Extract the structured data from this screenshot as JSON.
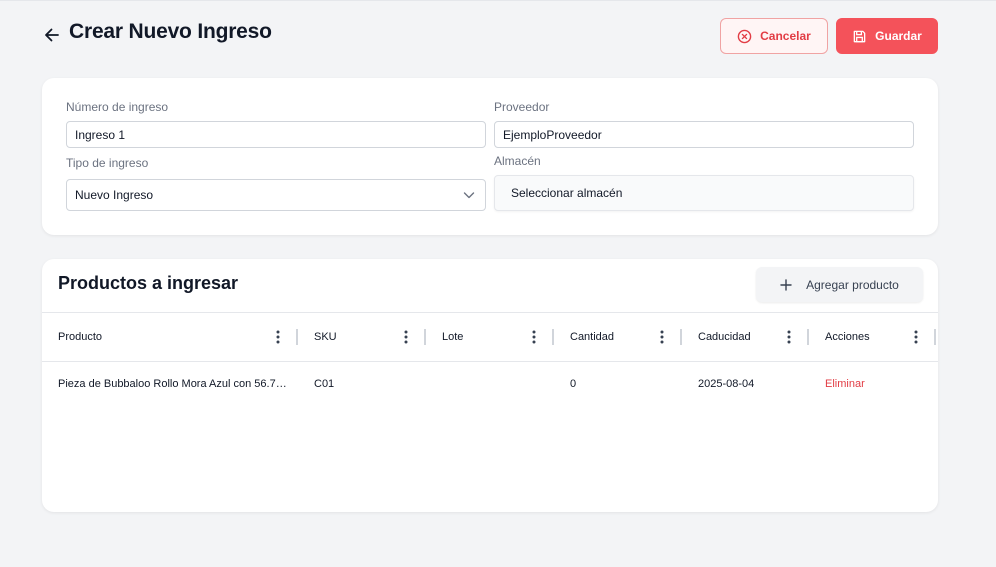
{
  "header": {
    "title": "Crear Nuevo Ingreso",
    "cancel_label": "Cancelar",
    "save_label": "Guardar"
  },
  "form": {
    "numero_label": "Número de ingreso",
    "numero_value": "Ingreso 1",
    "proveedor_label": "Proveedor",
    "proveedor_value": "EjemploProveedor",
    "tipo_label": "Tipo de ingreso",
    "tipo_value": "Nuevo Ingreso",
    "almacen_label": "Almacén",
    "almacen_value": "Seleccionar almacén"
  },
  "products": {
    "title": "Productos a ingresar",
    "add_label": "Agregar producto",
    "columns": [
      "Producto",
      "SKU",
      "Lote",
      "Cantidad",
      "Caducidad",
      "Acciones"
    ],
    "rows": [
      {
        "producto": "Pieza de Bubbaloo Rollo Mora Azul con 56.7…",
        "sku": "C01",
        "lote": "",
        "cantidad": "0",
        "caducidad": "2025-08-04",
        "accion": "Eliminar"
      }
    ]
  },
  "colors": {
    "accent": "#f4525a",
    "danger_text": "#e23d45",
    "background": "#f3f4f6"
  },
  "icons": {
    "back": "arrow-left-icon",
    "cancel": "x-circle-icon",
    "save": "floppy-disk-icon",
    "add": "plus-icon",
    "column_menu": "vertical-dots-icon",
    "select": "chevron-down-icon"
  }
}
